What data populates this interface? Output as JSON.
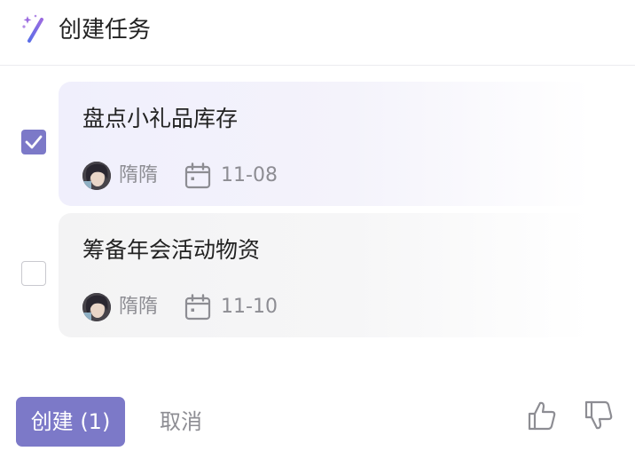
{
  "header": {
    "title": "创建任务",
    "icon": "magic-wand-icon",
    "accent": "#7c79c8"
  },
  "tasks": [
    {
      "checked": true,
      "title": "盘点小礼品库存",
      "assignee": "隋隋",
      "due": "11-08"
    },
    {
      "checked": false,
      "title": "筹备年会活动物资",
      "assignee": "隋隋",
      "due": "11-10"
    }
  ],
  "footer": {
    "create_label": "创建 (1)",
    "cancel_label": "取消",
    "like_icon": "thumbs-up-icon",
    "dislike_icon": "thumbs-down-icon"
  },
  "colors": {
    "primary": "#7c79c8",
    "muted_text": "#8d8d93",
    "selected_card": "#f0effc",
    "plain_card": "#f3f3f4"
  }
}
